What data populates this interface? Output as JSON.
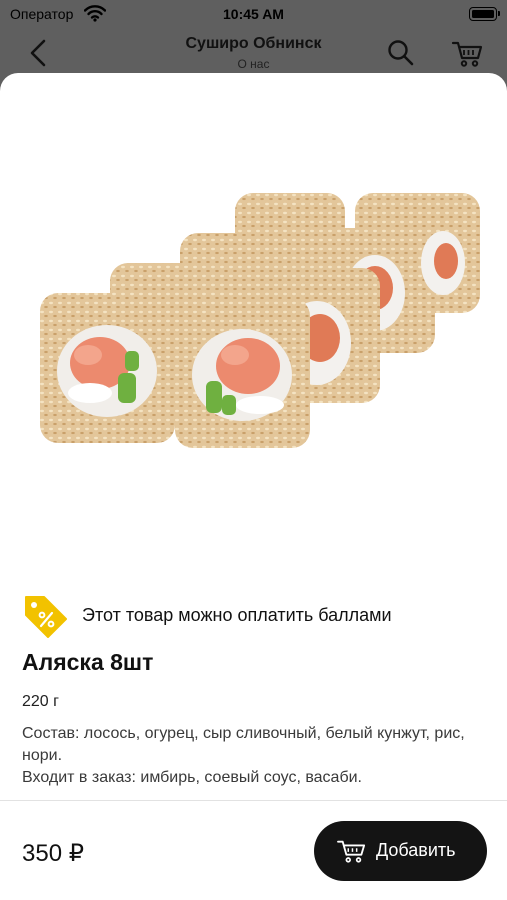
{
  "status_bar": {
    "carrier": "Оператор",
    "time": "10:45 AM"
  },
  "nav": {
    "title": "Суширо Обнинск",
    "subtitle": "О нас"
  },
  "product": {
    "points_note": "Этот товар можно оплатить баллами",
    "name": "Аляска 8шт",
    "weight": "220 г",
    "description_line1": "Состав: лосось, огурец, сыр сливочный, белый кунжут, рис, нори.",
    "description_line2": "Входит в заказ: имбирь, соевый соус, васаби.",
    "price": "350 ₽"
  },
  "actions": {
    "add_label": "Добавить"
  },
  "colors": {
    "accent_badge": "#f2c200",
    "button": "#141414",
    "overlay": "#5f5f5f"
  },
  "icons": {
    "back": "chevron-left-icon",
    "search": "search-icon",
    "cart": "cart-icon",
    "points": "percent-tag-icon",
    "wifi": "wifi-icon",
    "battery": "battery-icon"
  }
}
